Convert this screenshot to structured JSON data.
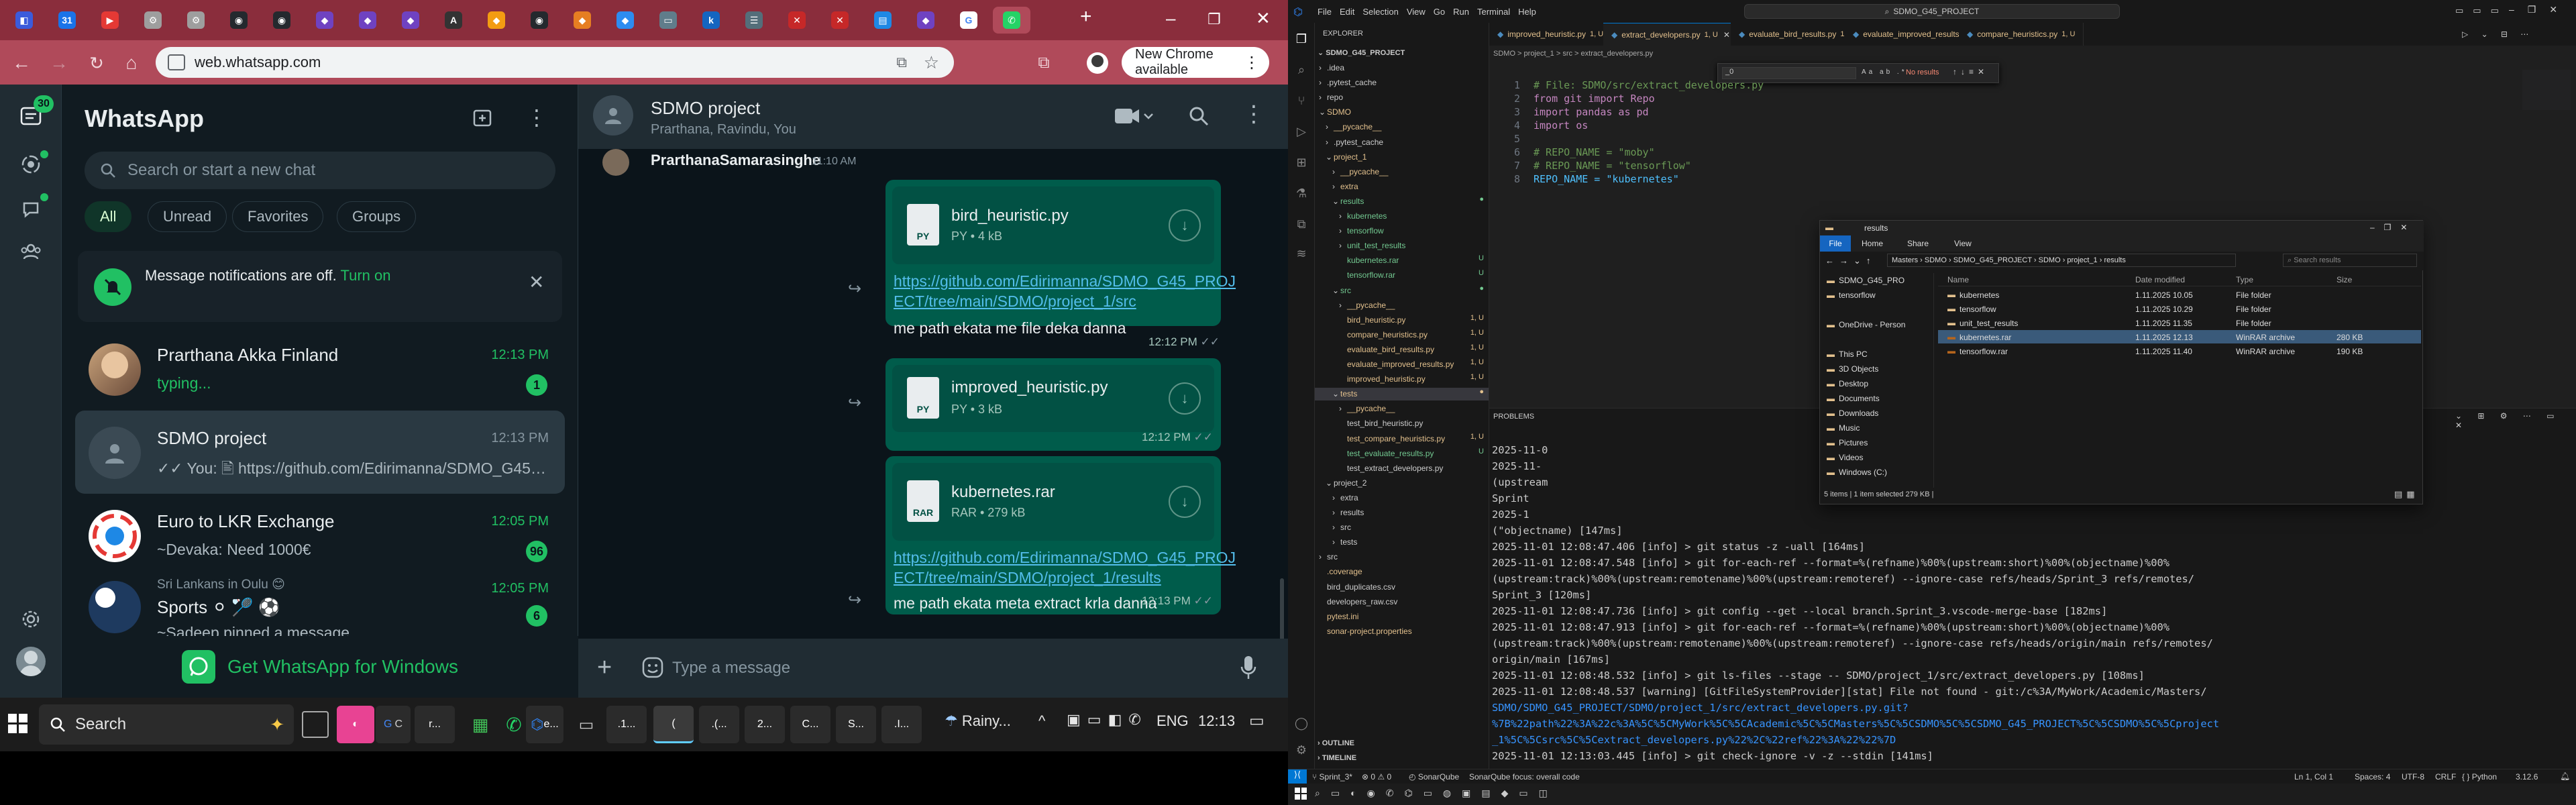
{
  "chrome": {
    "address": "web.whatsapp.com",
    "new_chrome_label": "New Chrome available",
    "tab_favicons": [
      {
        "icon": "nav-icon",
        "color": "#3b5bdb",
        "glyph": "◧"
      },
      {
        "icon": "calendar-icon",
        "color": "#1a73e8",
        "glyph": "31"
      },
      {
        "icon": "youtube-icon",
        "color": "#e53935",
        "glyph": "▶"
      },
      {
        "icon": "chrome-settings-icon",
        "color": "#9e9e9e",
        "glyph": "⚙"
      },
      {
        "icon": "chrome-settings-icon",
        "color": "#9e9e9e",
        "glyph": "⚙"
      },
      {
        "icon": "github-icon",
        "color": "#24292e",
        "glyph": "◉"
      },
      {
        "icon": "github-icon",
        "color": "#24292e",
        "glyph": "◉"
      },
      {
        "icon": "app-icon",
        "color": "#6f42c1",
        "glyph": "◆"
      },
      {
        "icon": "app-icon",
        "color": "#6f42c1",
        "glyph": "◆"
      },
      {
        "icon": "app-icon",
        "color": "#6f42c1",
        "glyph": "◆"
      },
      {
        "icon": "acm-icon",
        "color": "#333",
        "glyph": "A"
      },
      {
        "icon": "app-icon",
        "color": "#f39c12",
        "glyph": "◆"
      },
      {
        "icon": "github-icon",
        "color": "#24292e",
        "glyph": "◉"
      },
      {
        "icon": "app-icon",
        "color": "#e67e22",
        "glyph": "◆"
      },
      {
        "icon": "app-icon",
        "color": "#2d8cf0",
        "glyph": "◆"
      },
      {
        "icon": "folder-icon",
        "color": "#607d8b",
        "glyph": "▭"
      },
      {
        "icon": "app-icon",
        "color": "#1565c0",
        "glyph": "k"
      },
      {
        "icon": "app-icon",
        "color": "#546e7a",
        "glyph": "☰"
      },
      {
        "icon": "app-icon",
        "color": "#c62828",
        "glyph": "✕"
      },
      {
        "icon": "app-icon",
        "color": "#c62828",
        "glyph": "✕"
      },
      {
        "icon": "app-icon",
        "color": "#1e88e5",
        "glyph": "▤"
      },
      {
        "icon": "app-icon",
        "color": "#6f42c1",
        "glyph": "◆"
      },
      {
        "icon": "google-icon",
        "color": "#ffffff",
        "glyph": "G"
      },
      {
        "icon": "whatsapp-icon",
        "color": "#25d366",
        "glyph": "✆"
      }
    ]
  },
  "whatsapp": {
    "title": "WhatsApp",
    "rail_badge": "30",
    "search_placeholder": "Search or start a new chat",
    "filters": [
      "All",
      "Unread",
      "Favorites",
      "Groups"
    ],
    "notification": {
      "text": "Message notifications are off.",
      "action": "Turn on"
    },
    "chats": [
      {
        "name": "Prarthana Akka Finland",
        "time": "12:13 PM",
        "message": "typing...",
        "badge": "1",
        "time_color": "#21c063",
        "msg_color": "#21c063"
      },
      {
        "name": "SDMO project",
        "time": "12:13 PM",
        "message": "✓✓ You: 🖹 https://github.com/Edirimanna/SDMO_G45_PRO...",
        "badge": "",
        "time_color": "#8696a0",
        "msg_color": "#aebac1"
      },
      {
        "name": "Euro to LKR Exchange",
        "time": "12:05 PM",
        "message": "~Devaka: Need 1000€",
        "badge": "96",
        "time_color": "#21c063",
        "msg_color": "#aebac1"
      },
      {
        "name": "Sports ⚪ 🏸 ⚽",
        "time": "12:05 PM",
        "message": "~Sadeep pinned a message",
        "badge": "6",
        "time_color": "#21c063",
        "msg_color": "#aebac1",
        "group": "Sri Lankans in Oulu 😊"
      }
    ],
    "get_app": "Get WhatsApp for Windows",
    "conversation": {
      "name": "SDMO project",
      "members": "Prarthana, Ravindu, You",
      "top_sender": "PrarthanaSamarasinghe",
      "top_time": "11:10 AM",
      "messages": [
        {
          "file": "bird_heuristic.py",
          "meta": "PY • 4 kB",
          "link": "https://github.com/Edirimanna/SDMO_G45_PROJECT/tree/main/SDMO/project_1/src",
          "link_lines": [
            "https://github.com/Edirimanna/SDMO_G45_PROJ",
            "ECT/tree/main/SDMO/project_1/src"
          ],
          "caption": "me path ekata me file deka danna",
          "time": "12:12 PM"
        },
        {
          "file": "improved_heuristic.py",
          "meta": "PY • 3 kB",
          "time": "12:12 PM"
        },
        {
          "file": "kubernetes.rar",
          "meta": "RAR • 279 kB",
          "link_lines": [
            "https://github.com/Edirimanna/SDMO_G45_PROJ",
            "ECT/tree/main/SDMO/project_1/results"
          ],
          "caption": "me path ekata meta extract krla danna",
          "time": "12:13 PM"
        }
      ],
      "compose_placeholder": "Type a message"
    }
  },
  "taskbar": {
    "search": "Search",
    "weather": "Rainy...",
    "lang": "ENG",
    "time": "12:13",
    "apps": [
      "r...",
      "e...",
      "",
      ".1...",
      "(",
      ".(...",
      "2...",
      "C...",
      "S...",
      ".I..."
    ]
  },
  "vscode": {
    "search": "SDMO_G45_PROJECT",
    "menu": [
      "File",
      "Edit",
      "Selection",
      "View",
      "Go",
      "Run",
      "Terminal",
      "Help"
    ],
    "explorer_title": "EXPLORER",
    "project": "SDMO_G45_PROJECT",
    "tabs": [
      {
        "name": "improved_heuristic.py",
        "status": "1, U"
      },
      {
        "name": "extract_developers.py",
        "status": "1, U",
        "active": true
      },
      {
        "name": "evaluate_bird_results.py",
        "status": "1, U"
      },
      {
        "name": "evaluate_improved_results.py",
        "status": "1, U"
      },
      {
        "name": "compare_heuristics.py",
        "status": "1, U"
      }
    ],
    "breadcrumb": "SDMO > project_1 > src > extract_developers.py",
    "find": {
      "value": "_0",
      "result": "No results"
    },
    "tree": [
      {
        "d": 0,
        "t": ".idea",
        "k": "folder"
      },
      {
        "d": 0,
        "t": ".pytest_cache",
        "k": "folder"
      },
      {
        "d": 0,
        "t": "repo",
        "k": "folder"
      },
      {
        "d": 0,
        "t": "SDMO",
        "k": "folder-open",
        "c": "#e2c08d"
      },
      {
        "d": 1,
        "t": "__pycache__",
        "k": "folder",
        "c": "#e2c08d"
      },
      {
        "d": 1,
        "t": ".pytest_cache",
        "k": "folder"
      },
      {
        "d": 1,
        "t": "project_1",
        "k": "folder-open",
        "c": "#e2c08d"
      },
      {
        "d": 2,
        "t": "__pycache__",
        "k": "folder",
        "c": "#e2c08d"
      },
      {
        "d": 2,
        "t": "extra",
        "k": "folder",
        "c": "#e2c08d"
      },
      {
        "d": 2,
        "t": "results",
        "k": "folder-open",
        "c": "#73c991",
        "s": "●"
      },
      {
        "d": 3,
        "t": "kubernetes",
        "k": "folder",
        "c": "#73c991"
      },
      {
        "d": 3,
        "t": "tensorflow",
        "k": "folder",
        "c": "#73c991"
      },
      {
        "d": 3,
        "t": "unit_test_results",
        "k": "folder",
        "c": "#73c991"
      },
      {
        "d": 3,
        "t": "kubernetes.rar",
        "k": "file",
        "c": "#73c991",
        "s": "U"
      },
      {
        "d": 3,
        "t": "tensorflow.rar",
        "k": "file",
        "c": "#73c991",
        "s": "U"
      },
      {
        "d": 2,
        "t": "src",
        "k": "folder-open",
        "c": "#73c991",
        "s": "●"
      },
      {
        "d": 3,
        "t": "__pycache__",
        "k": "folder",
        "c": "#e2c08d"
      },
      {
        "d": 3,
        "t": "bird_heuristic.py",
        "k": "file",
        "c": "#e2c08d",
        "s": "1, U"
      },
      {
        "d": 3,
        "t": "compare_heuristics.py",
        "k": "file",
        "c": "#e2c08d",
        "s": "1, U"
      },
      {
        "d": 3,
        "t": "evaluate_bird_results.py",
        "k": "file",
        "c": "#e2c08d",
        "s": "1, U"
      },
      {
        "d": 3,
        "t": "evaluate_improved_results.py",
        "k": "file",
        "c": "#e2c08d",
        "s": "1, U"
      },
      {
        "d": 3,
        "t": "improved_heuristic.py",
        "k": "file",
        "c": "#e2c08d",
        "s": "1, U"
      },
      {
        "d": 2,
        "t": "tests",
        "k": "folder-open",
        "c": "#e2c08d",
        "s": "●",
        "sel": true
      },
      {
        "d": 3,
        "t": "__pycache__",
        "k": "folder",
        "c": "#e2c08d"
      },
      {
        "d": 3,
        "t": "test_bird_heuristic.py",
        "k": "file",
        "c": "#cccccc"
      },
      {
        "d": 3,
        "t": "test_compare_heuristics.py",
        "k": "file",
        "c": "#e2c08d",
        "s": "1, U"
      },
      {
        "d": 3,
        "t": "test_evaluate_results.py",
        "k": "file",
        "c": "#73c991",
        "s": "U"
      },
      {
        "d": 3,
        "t": "test_extract_developers.py",
        "k": "file",
        "c": "#cccccc"
      },
      {
        "d": 1,
        "t": "project_2",
        "k": "folder-open",
        "c": "#cccccc"
      },
      {
        "d": 2,
        "t": "extra",
        "k": "folder"
      },
      {
        "d": 2,
        "t": "results",
        "k": "folder"
      },
      {
        "d": 2,
        "t": "src",
        "k": "folder"
      },
      {
        "d": 2,
        "t": "tests",
        "k": "folder"
      },
      {
        "d": 0,
        "t": "src",
        "k": "folder"
      },
      {
        "d": 0,
        "t": ".coverage",
        "k": "file",
        "c": "#e2c08d"
      },
      {
        "d": 0,
        "t": "bird_duplicates.csv",
        "k": "file",
        "c": "#cccccc"
      },
      {
        "d": 0,
        "t": "developers_raw.csv",
        "k": "file",
        "c": "#cccccc"
      },
      {
        "d": 0,
        "t": "pytest.ini",
        "k": "file",
        "c": "#e2c08d"
      },
      {
        "d": 0,
        "t": "sonar-project.properties",
        "k": "file",
        "c": "#e2c08d"
      }
    ],
    "outline": "OUTLINE",
    "timeline": "TIMELINE",
    "code": [
      {
        "n": "1",
        "t": "# File: SDMO/src/extract_developers.py",
        "c": "#6a9955"
      },
      {
        "n": "2",
        "t": "from git import Repo",
        "c": "#c586c0"
      },
      {
        "n": "3",
        "t": "import pandas as pd",
        "c": "#c586c0"
      },
      {
        "n": "4",
        "t": "import os",
        "c": "#c586c0"
      },
      {
        "n": "5",
        "t": "",
        "c": "#d4d4d4"
      },
      {
        "n": "6",
        "t": "# REPO_NAME = \"moby\"",
        "c": "#6a9955"
      },
      {
        "n": "7",
        "t": "# REPO_NAME = \"tensorflow\"",
        "c": "#6a9955"
      },
      {
        "n": "8",
        "t": "REPO_NAME = \"kubernetes\"",
        "c": "#4fc1ff"
      }
    ],
    "terminal_tab": "PROBLEMS",
    "terminal": [
      {
        "t": "2025-11-0",
        "c": "#cccccc"
      },
      {
        "t": "2025-11-",
        "c": "#cccccc"
      },
      {
        "t": "(upstream",
        "c": "#cccccc"
      },
      {
        "t": "Sprint",
        "c": "#cccccc"
      },
      {
        "t": "2025-1",
        "c": "#cccccc"
      },
      {
        "t": "(\"objectname) [147ms]",
        "c": "#cccccc"
      },
      {
        "t": "2025-11-01 12:08:47.406 [info] > git status -z -uall [164ms]",
        "c": "#cccccc"
      },
      {
        "t": "2025-11-01 12:08:47.548 [info] > git for-each-ref --format=%(refname)%00%(upstream:short)%00%(objectname)%00%",
        "c": "#cccccc"
      },
      {
        "t": "(upstream:track)%00%(upstream:remotename)%00%(upstream:remoteref) --ignore-case refs/heads/Sprint_3 refs/remotes/",
        "c": "#cccccc"
      },
      {
        "t": "Sprint_3 [120ms]",
        "c": "#cccccc"
      },
      {
        "t": "2025-11-01 12:08:47.736 [info] > git config --get --local branch.Sprint_3.vscode-merge-base [182ms]",
        "c": "#cccccc"
      },
      {
        "t": "2025-11-01 12:08:47.913 [info] > git for-each-ref --format=%(refname)%00%(upstream:short)%00%(objectname)%00%",
        "c": "#cccccc"
      },
      {
        "t": "(upstream:track)%00%(upstream:remotename)%00%(upstream:remoteref) --ignore-case refs/heads/origin/main refs/remotes/",
        "c": "#cccccc"
      },
      {
        "t": "origin/main [167ms]",
        "c": "#cccccc"
      },
      {
        "t": "2025-11-01 12:08:48.532 [info] > git ls-files --stage -- SDMO/project_1/src/extract_developers.py [108ms]",
        "c": "#cccccc"
      },
      {
        "t": "2025-11-01 12:08:48.537 [warning] [GitFileSystemProvider][stat] File not found - git:/c%3A/MyWork/Academic/Masters/",
        "c": "#cccccc"
      },
      {
        "t": "SDMO/SDMO_G45_PROJECT/SDMO/project_1/src/extract_developers.py.git?",
        "c": "#3794ff"
      },
      {
        "t": "%7B%22path%22%3A%22c%3A%5C%5CMyWork%5C%5CAcademic%5C%5CMasters%5C%5CSDMO%5C%5CSDMO_G45_PROJECT%5C%5CSDMO%5C%5Cproject",
        "c": "#3794ff"
      },
      {
        "t": "_1%5C%5Csrc%5C%5Cextract_developers.py%22%2C%22ref%22%3A%22%22%7D",
        "c": "#3794ff"
      },
      {
        "t": "2025-11-01 12:13:03.445 [info] > git check-ignore -v -z --stdin [141ms]",
        "c": "#cccccc"
      }
    ],
    "status": {
      "branch": "Sprint_3*",
      "problems": "0 ⚠ 0",
      "sonar": "SonarQube",
      "sonar_focus": "SonarQube focus: overall code",
      "position": "Ln 1, Col 1",
      "spaces": "Spaces: 4",
      "encoding": "UTF-8",
      "eol": "CRLF",
      "language": "Python",
      "version": "3.12.6"
    }
  },
  "explorer_window": {
    "title": "results",
    "ribbon": [
      "File",
      "Home",
      "Share",
      "View"
    ],
    "path": [
      "Masters",
      "SDMO",
      "SDMO_G45_PROJECT",
      "SDMO",
      "project_1",
      "results"
    ],
    "search_placeholder": "Search results",
    "nav": [
      "SDMO_G45_PRO",
      "tensorflow",
      "",
      "OneDrive - Person",
      "",
      "This PC",
      "3D Objects",
      "Desktop",
      "Documents",
      "Downloads",
      "Music",
      "Pictures",
      "Videos",
      "Windows (C:)"
    ],
    "columns": [
      "Name",
      "Date modified",
      "Type",
      "Size"
    ],
    "rows": [
      {
        "name": "kubernetes",
        "date": "1.11.2025 10.05",
        "type": "File folder",
        "size": "",
        "icon": "folder"
      },
      {
        "name": "tensorflow",
        "date": "1.11.2025 10.29",
        "type": "File folder",
        "size": "",
        "icon": "folder"
      },
      {
        "name": "unit_test_results",
        "date": "1.11.2025 11.35",
        "type": "File folder",
        "size": "",
        "icon": "folder"
      },
      {
        "name": "kubernetes.rar",
        "date": "1.11.2025 12.13",
        "type": "WinRAR archive",
        "size": "280 KB",
        "icon": "rar",
        "sel": true
      },
      {
        "name": "tensorflow.rar",
        "date": "1.11.2025 11.40",
        "type": "WinRAR archive",
        "size": "190 KB",
        "icon": "rar"
      }
    ],
    "status": "5 items | 1 item selected 279 KB |"
  }
}
